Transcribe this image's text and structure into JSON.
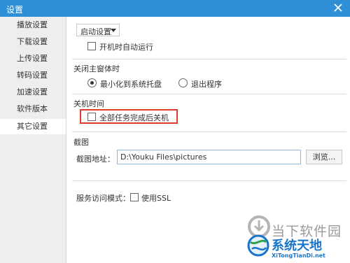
{
  "window": {
    "title": "设置"
  },
  "sidebar": {
    "items": [
      {
        "label": "播放设置"
      },
      {
        "label": "下载设置"
      },
      {
        "label": "上传设置"
      },
      {
        "label": "转码设置"
      },
      {
        "label": "加速设置"
      },
      {
        "label": "软件版本"
      },
      {
        "label": "其它设置"
      }
    ],
    "active_index": 6
  },
  "startup": {
    "dropdown_label": "启动设置",
    "autorun_label": "开机时自动运行",
    "autorun_checked": false
  },
  "close_main": {
    "heading": "关闭主窗体时",
    "options": [
      {
        "label": "最小化到系统托盘",
        "selected": true
      },
      {
        "label": "退出程序",
        "selected": false
      }
    ]
  },
  "shutdown": {
    "heading": "关机时间",
    "checkbox_label": "全部任务完成后关机",
    "checked": false
  },
  "screenshot": {
    "heading": "截图",
    "path_label": "截图地址：",
    "path_value": "D:\\Youku Files\\pictures",
    "browse_label": "浏览..."
  },
  "service": {
    "label": "服务访问模式：",
    "ssl_label": "使用SSL",
    "ssl_checked": false
  },
  "watermark": {
    "line1": "当下软件园",
    "line2": "系统天地",
    "url": "XiTongTianDi.net"
  },
  "colors": {
    "titlebar": "#2e8fd6",
    "highlight_border": "#e23c2c",
    "watermark_blue": "#1a74c9"
  }
}
